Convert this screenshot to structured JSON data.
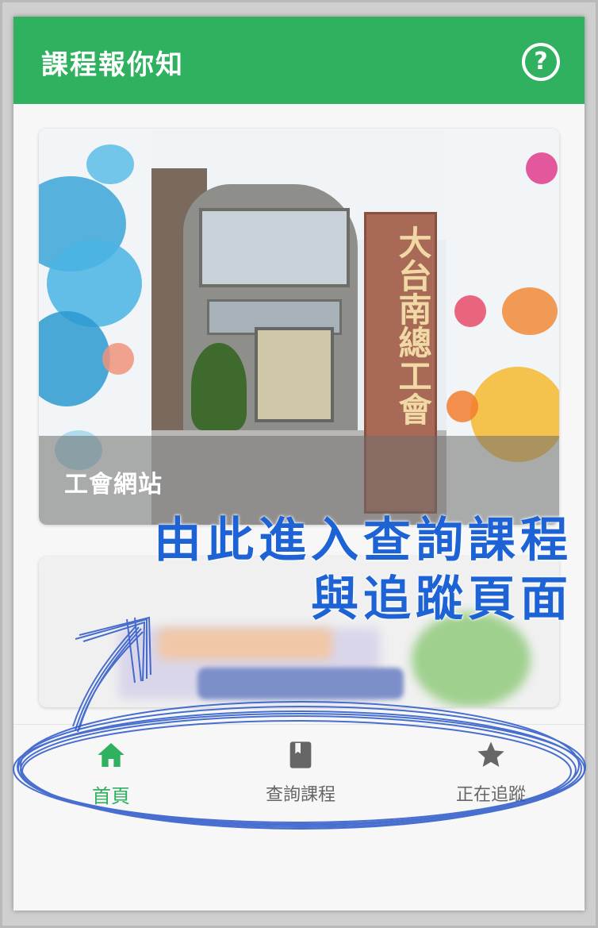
{
  "app_bar": {
    "title": "課程報你知",
    "help_icon": "help-circle-icon"
  },
  "cards": [
    {
      "caption": "工會網站",
      "sign_text": "大台南總工會"
    },
    {
      "caption": ""
    }
  ],
  "annotation": {
    "line1": "由此進入查詢課程",
    "line2": "與追蹤頁面",
    "color": "#1e63d6"
  },
  "bottom_nav": {
    "items": [
      {
        "label": "首頁",
        "icon": "home-icon",
        "active": true
      },
      {
        "label": "查詢課程",
        "icon": "book-icon",
        "active": false
      },
      {
        "label": "正在追蹤",
        "icon": "star-icon",
        "active": false
      }
    ],
    "active_color": "#2fb160",
    "inactive_color": "#666666"
  },
  "colors": {
    "primary": "#2fb160",
    "annotation_blue": "#1e63d6"
  }
}
